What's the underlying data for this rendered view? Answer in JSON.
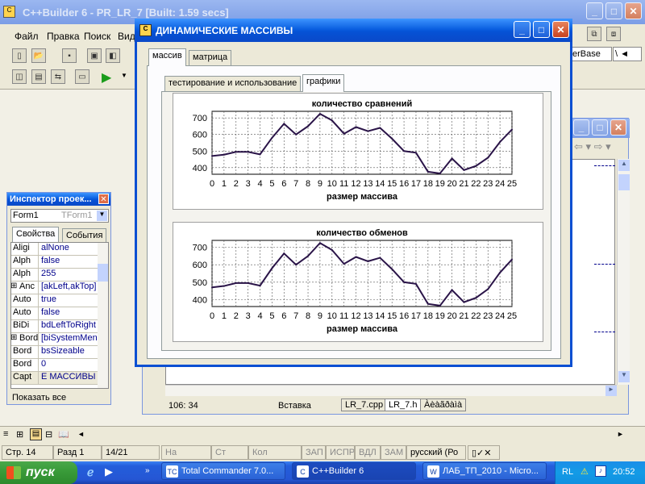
{
  "ide": {
    "title": "C++Builder 6 - PR_LR_7 [Built: 1.59 secs]",
    "menu": [
      "Файл",
      "Правка",
      "Поиск",
      "Вид"
    ],
    "combo_text": "erBase",
    "status": {
      "row": "Стр. 14",
      "section": "Разд 1",
      "page": "14/21",
      "on": "На",
      "st": "Ст",
      "col": "Кол",
      "zap": "ЗАП",
      "ispr": "ИСПР",
      "vdl": "ВДЛ",
      "zam": "ЗАМ",
      "lang": "русский (Ро"
    }
  },
  "editor": {
    "position": "106:  34",
    "mode": "Вставка",
    "tabs": [
      "LR_7.cpp",
      "LR_7.h",
      "Àèàãðàìà"
    ]
  },
  "inspector": {
    "title": "Инспектор проек...",
    "object_name": "Form1",
    "object_type": "TForm1",
    "tabs": [
      "Свойства",
      "События"
    ],
    "rows": [
      {
        "k": "Aligi",
        "v": "alNone",
        "plus": false
      },
      {
        "k": "Alph",
        "v": "false",
        "plus": false
      },
      {
        "k": "Alph",
        "v": "255",
        "plus": false
      },
      {
        "k": "Anc",
        "v": "[akLeft,akTop]",
        "plus": true
      },
      {
        "k": "Auto",
        "v": "true",
        "plus": false
      },
      {
        "k": "Auto",
        "v": "false",
        "plus": false
      },
      {
        "k": "BiDi",
        "v": "bdLeftToRight",
        "plus": false
      },
      {
        "k": "Bord",
        "v": "[biSystemMenu",
        "plus": true
      },
      {
        "k": "Bord",
        "v": "bsSizeable",
        "plus": false
      },
      {
        "k": "Bord",
        "v": "0",
        "plus": false
      },
      {
        "k": "Capt",
        "v": "Е МАССИВЫ",
        "plus": false
      }
    ],
    "footer": "Показать все"
  },
  "dialog": {
    "title": "ДИНАМИЧЕСКИЕ  МАССИВЫ",
    "outer_tabs": [
      "массив",
      "матрица"
    ],
    "inner_tabs": [
      "тестирование и использование",
      "графики"
    ]
  },
  "taskbar": {
    "start": "пуск",
    "buttons": [
      "Total Commander 7.0...",
      "C++Builder 6",
      "ЛАБ_ТП_2010 - Micro..."
    ],
    "lang": "RL",
    "time": "20:52"
  },
  "colors": {
    "series": "#2a1448",
    "desktop": "#5a7edc"
  },
  "chart_data": [
    {
      "type": "line",
      "title": "количество сравнений",
      "xlabel": "размер массива",
      "ylabel": "",
      "x": [
        0,
        1,
        2,
        3,
        4,
        5,
        6,
        7,
        8,
        9,
        10,
        11,
        12,
        13,
        14,
        15,
        16,
        17,
        18,
        19,
        20,
        21,
        22,
        23,
        24,
        25
      ],
      "values": [
        470,
        478,
        495,
        495,
        480,
        580,
        665,
        600,
        650,
        725,
        685,
        605,
        645,
        620,
        640,
        575,
        500,
        490,
        375,
        365,
        455,
        385,
        410,
        460,
        555,
        630
      ],
      "ylim": [
        360,
        740
      ],
      "yticks": [
        400,
        500,
        600,
        700
      ],
      "grid": true
    },
    {
      "type": "line",
      "title": "количество обменов",
      "xlabel": "размер массива",
      "ylabel": "",
      "x": [
        0,
        1,
        2,
        3,
        4,
        5,
        6,
        7,
        8,
        9,
        10,
        11,
        12,
        13,
        14,
        15,
        16,
        17,
        18,
        19,
        20,
        21,
        22,
        23,
        24,
        25
      ],
      "values": [
        470,
        478,
        495,
        495,
        480,
        580,
        665,
        600,
        650,
        725,
        685,
        605,
        645,
        620,
        640,
        575,
        500,
        490,
        375,
        365,
        455,
        385,
        410,
        460,
        555,
        630
      ],
      "ylim": [
        360,
        740
      ],
      "yticks": [
        400,
        500,
        600,
        700
      ],
      "grid": true
    }
  ]
}
